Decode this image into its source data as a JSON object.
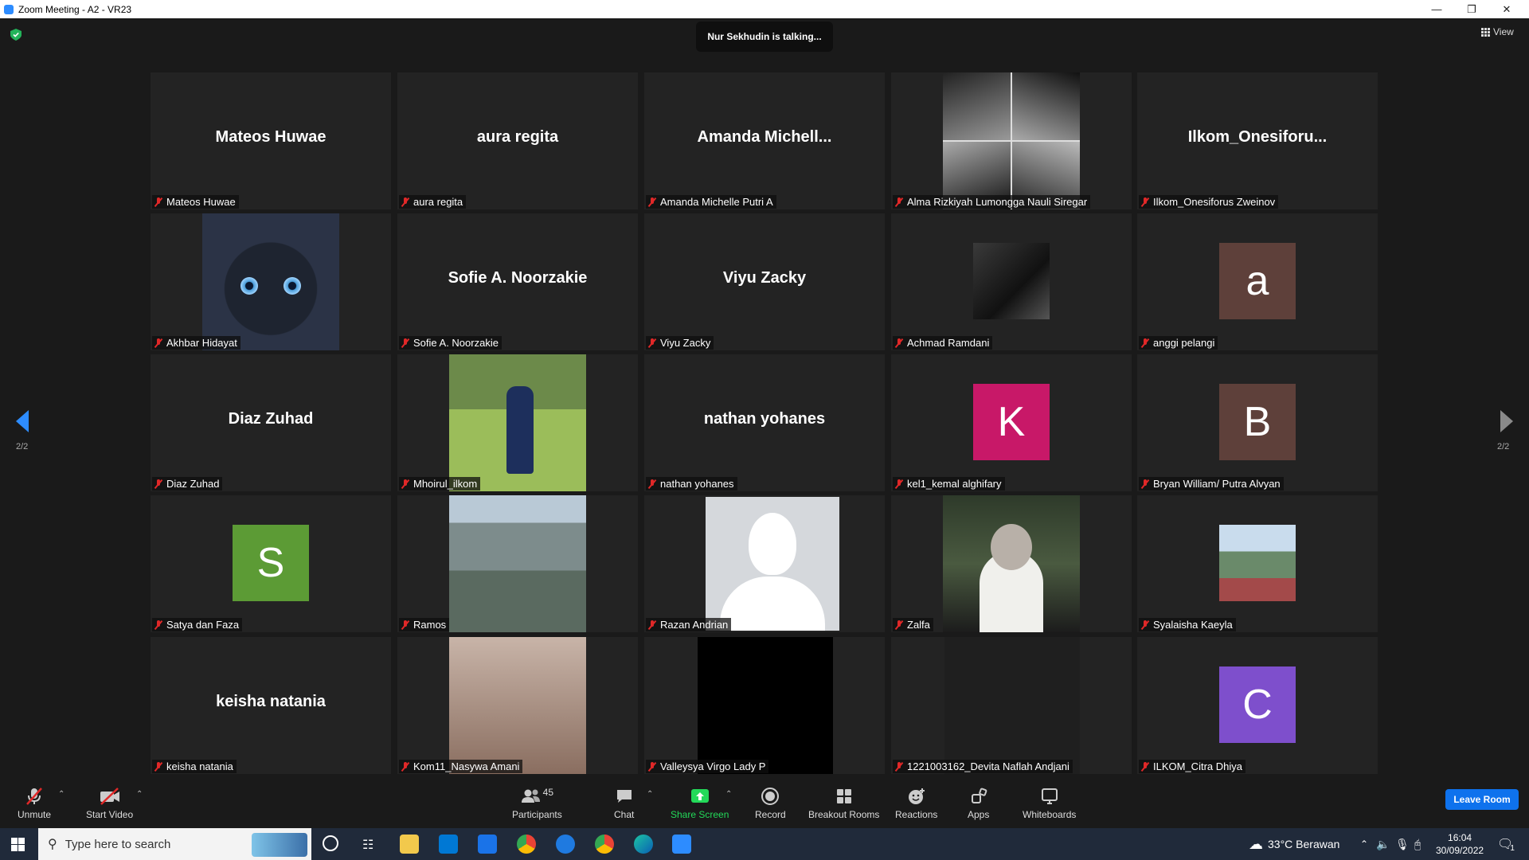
{
  "window": {
    "title": "Zoom Meeting - A2 - VR23"
  },
  "meeting": {
    "talking": "Nur Sekhudin is talking...",
    "view_label": "View",
    "page_left": "2/2",
    "page_right": "2/2"
  },
  "tiles": [
    {
      "name": "Mateos Huwae",
      "display": "Mateos Huwae",
      "kind": "name"
    },
    {
      "name": "aura regita",
      "display": "aura regita",
      "kind": "name"
    },
    {
      "name": "Amanda Michelle Putri A",
      "display": "Amanda  Michell...",
      "kind": "name"
    },
    {
      "name": "Alma Rizkiyah Lumongga Nauli Siregar",
      "kind": "photo-collage"
    },
    {
      "name": "Ilkom_Onesiforus Zweinov",
      "display": "Ilkom_Onesiforu...",
      "kind": "name"
    },
    {
      "name": "Akhbar Hidayat",
      "kind": "photo-cat"
    },
    {
      "name": "Sofie A. Noorzakie",
      "display": "Sofie A. Noorzakie",
      "kind": "name"
    },
    {
      "name": "Viyu Zacky",
      "display": "Viyu Zacky",
      "kind": "name"
    },
    {
      "name": "Achmad Ramdani",
      "kind": "photo-small"
    },
    {
      "name": "anggi pelangi",
      "letter": "a",
      "color": "#5e403a",
      "kind": "avatar"
    },
    {
      "name": "Diaz Zuhad",
      "display": "Diaz Zuhad",
      "kind": "name"
    },
    {
      "name": "Mhoirul_ilkom",
      "kind": "photo-field"
    },
    {
      "name": "nathan yohanes",
      "display": "nathan yohanes",
      "kind": "name"
    },
    {
      "name": "kel1_kemal alghifary",
      "letter": "K",
      "color": "#c81868",
      "kind": "avatar"
    },
    {
      "name": "Bryan William/ Putra Alvyan",
      "letter": "B",
      "color": "#5e403a",
      "kind": "avatar"
    },
    {
      "name": "Satya dan Faza",
      "letter": "S",
      "color": "#5c9b35",
      "kind": "avatar"
    },
    {
      "name": "Ramos",
      "kind": "photo-beach"
    },
    {
      "name": "Razan Andrian",
      "kind": "photo-silhouette"
    },
    {
      "name": "Zalfa",
      "kind": "photo-person"
    },
    {
      "name": "Syalaisha Kaeyla",
      "kind": "photo-landscape"
    },
    {
      "name": "keisha natania",
      "display": "keisha natania",
      "kind": "name"
    },
    {
      "name": "Kom11_Nasywa Amani",
      "kind": "photo-group"
    },
    {
      "name": "Valleysya Virgo Lady P",
      "kind": "photo-black"
    },
    {
      "name": "1221003162_Devita Naflah Andjani",
      "kind": "photo-dark"
    },
    {
      "name": "ILKOM_Citra Dhiya",
      "letter": "C",
      "color": "#7e4fcc",
      "kind": "avatar"
    }
  ],
  "toolbar": {
    "unmute": "Unmute",
    "start_video": "Start Video",
    "participants": "Participants",
    "participants_count": "45",
    "chat": "Chat",
    "share_screen": "Share Screen",
    "record": "Record",
    "breakout": "Breakout Rooms",
    "reactions": "Reactions",
    "apps": "Apps",
    "whiteboards": "Whiteboards",
    "leave": "Leave Room"
  },
  "taskbar": {
    "search_placeholder": "Type here to search",
    "weather": "33°C  Berawan",
    "time": "16:04",
    "date": "30/09/2022",
    "notifications": "1"
  },
  "colors": {
    "accent": "#2d8cff",
    "leave": "#0e72ed",
    "share": "#23d959",
    "muted": "#e02828"
  }
}
